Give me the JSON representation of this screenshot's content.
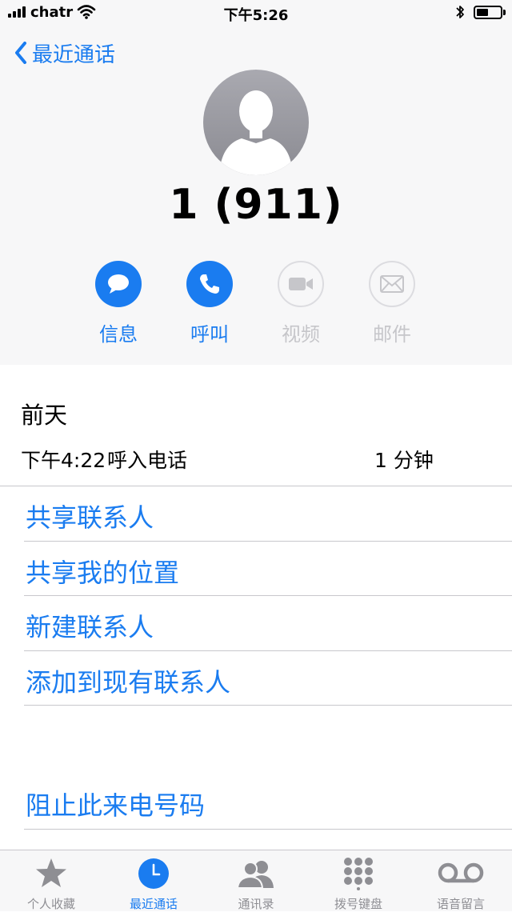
{
  "status_bar": {
    "carrier": "chatr",
    "time": "下午5:26",
    "signal_bars": 4,
    "battery_level": 0.5
  },
  "nav": {
    "back_label": "最近通话"
  },
  "contact": {
    "number": "1 (911)"
  },
  "actions": [
    {
      "label": "信息",
      "icon": "message-icon",
      "enabled": true
    },
    {
      "label": "呼叫",
      "icon": "phone-icon",
      "enabled": true
    },
    {
      "label": "视频",
      "icon": "video-icon",
      "enabled": false
    },
    {
      "label": "邮件",
      "icon": "mail-icon",
      "enabled": false
    }
  ],
  "recent": {
    "section_title": "前天",
    "call": {
      "time": "下午4:22",
      "type": "呼入电话",
      "duration": "1 分钟"
    }
  },
  "options": [
    "共享联系人",
    "共享我的位置",
    "新建联系人",
    "添加到现有联系人"
  ],
  "block_label": "阻止此来电号码",
  "tabs": [
    {
      "label": "个人收藏",
      "icon": "star-icon",
      "active": false
    },
    {
      "label": "最近通话",
      "icon": "clock-icon",
      "active": true
    },
    {
      "label": "通讯录",
      "icon": "contacts-icon",
      "active": false
    },
    {
      "label": "拨号键盘",
      "icon": "keypad-icon",
      "active": false
    },
    {
      "label": "语音留言",
      "icon": "voicemail-icon",
      "active": false
    }
  ],
  "colors": {
    "accent": "#1a7cf0",
    "header_bg": "#f7f7f8",
    "disabled": "#c6c6ca",
    "inactive_tab": "#8e8e93"
  }
}
